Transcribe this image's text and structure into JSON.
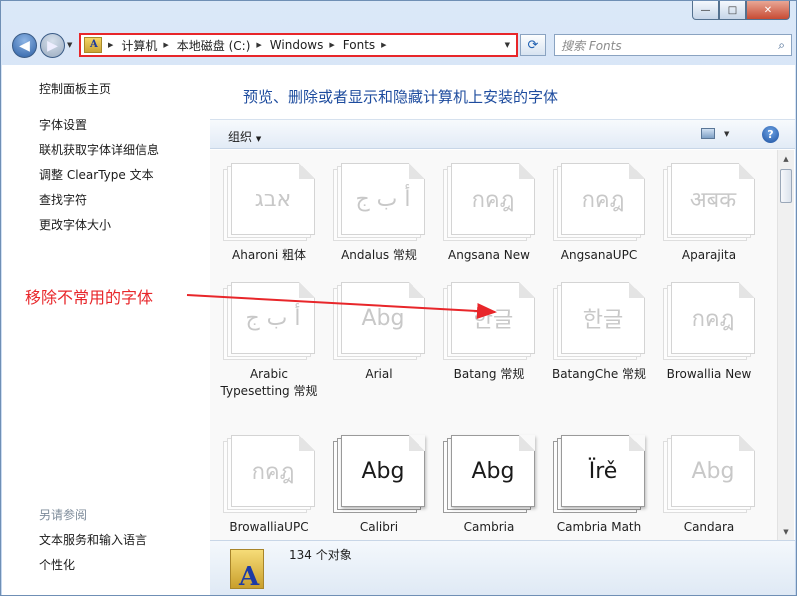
{
  "window_controls": {
    "minimize": "—",
    "maximize": "□",
    "close": "✕"
  },
  "nav": {
    "back_icon": "◀",
    "forward_icon": "▶",
    "history_icon": "▼"
  },
  "address": {
    "crumbs": [
      "计算机",
      "本地磁盘 (C:)",
      "Windows",
      "Fonts"
    ],
    "separator": "▶",
    "dropdown_icon": "▼",
    "refresh_icon": "⟳"
  },
  "search": {
    "placeholder": "搜索 Fonts",
    "icon": "⌕"
  },
  "sidebar": {
    "home": "控制面板主页",
    "links": [
      "字体设置",
      "联机获取字体详细信息",
      "调整 ClearType 文本",
      "查找字符",
      "更改字体大小"
    ],
    "see_also_heading": "另请参阅",
    "see_also": [
      "文本服务和输入语言",
      "个性化"
    ]
  },
  "main": {
    "title": "预览、删除或者显示和隐藏计算机上安装的字体",
    "toolbar": {
      "organize": "组织",
      "organize_drop": "▼",
      "view_drop": "▼",
      "help": "?"
    },
    "fonts": [
      {
        "name": "Aharoni 粗体",
        "sample": "אבג",
        "style": "faded"
      },
      {
        "name": "Andalus 常规",
        "sample": "أ ب ج",
        "style": "faded"
      },
      {
        "name": "Angsana New",
        "sample": "กคฎ",
        "style": "faded"
      },
      {
        "name": "AngsanaUPC",
        "sample": "กคฎ",
        "style": "faded"
      },
      {
        "name": "Aparajita",
        "sample": "अबक",
        "style": "faded"
      },
      {
        "name": "Arabic Typesetting 常规",
        "sample": "أ ب ج",
        "style": "faded"
      },
      {
        "name": "Arial",
        "sample": "Abg",
        "style": "faded"
      },
      {
        "name": "Batang 常规",
        "sample": "한글",
        "style": "faded"
      },
      {
        "name": "BatangChe 常规",
        "sample": "한글",
        "style": "faded"
      },
      {
        "name": "Browallia New",
        "sample": "กคฎ",
        "style": "faded"
      },
      {
        "name": "BrowalliaUPC",
        "sample": "กคฎ",
        "style": "faded"
      },
      {
        "name": "Calibri",
        "sample": "Abg",
        "style": "dark"
      },
      {
        "name": "Cambria",
        "sample": "Abg",
        "style": "dark"
      },
      {
        "name": "Cambria Math",
        "sample": "Ïrě",
        "style": "dark"
      },
      {
        "name": "Candara",
        "sample": "Abg",
        "style": "faded"
      }
    ],
    "status": {
      "count": "134 个对象"
    }
  },
  "annotation": {
    "text": "移除不常用的字体",
    "color": "#e8262a"
  },
  "colors": {
    "title": "#1e4c9e",
    "highlight": "#e8262a"
  }
}
